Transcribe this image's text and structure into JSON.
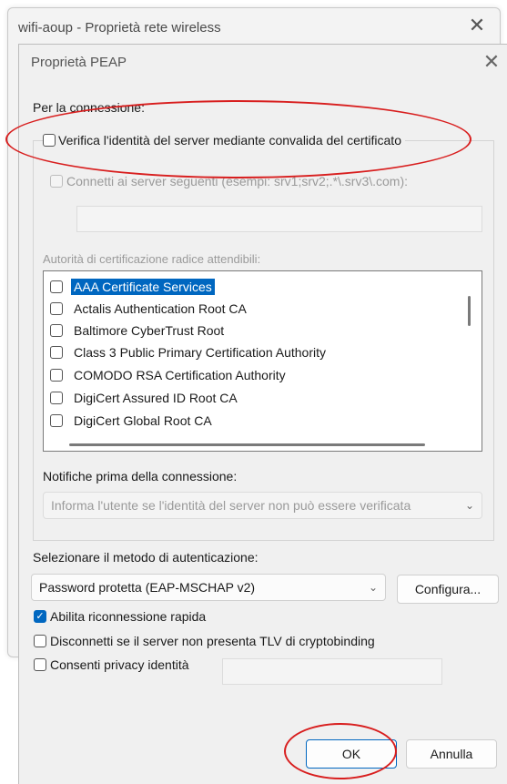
{
  "back_window": {
    "title": "wifi-aoup - Proprietà rete wireless",
    "close_glyph": "✕"
  },
  "dialog": {
    "title": "Proprietà PEAP",
    "close_glyph": "✕"
  },
  "connection": {
    "section_label": "Per la connessione:",
    "verify_server": {
      "label": "Verifica l'identità del server mediante convalida del certificato",
      "checked": false
    },
    "connect_servers": {
      "label": "Connetti ai server seguenti (esempi: srv1;srv2;.*\\.srv3\\.com):",
      "checked": false,
      "value": ""
    },
    "trusted_ca_label": "Autorità di certificazione radice attendibili:",
    "certificates": [
      {
        "label": "AAA Certificate Services",
        "checked": false,
        "selected": true
      },
      {
        "label": "Actalis Authentication Root CA",
        "checked": false,
        "selected": false
      },
      {
        "label": "Baltimore CyberTrust Root",
        "checked": false,
        "selected": false
      },
      {
        "label": "Class 3 Public Primary Certification Authority",
        "checked": false,
        "selected": false
      },
      {
        "label": "COMODO RSA Certification Authority",
        "checked": false,
        "selected": false
      },
      {
        "label": "DigiCert Assured ID Root CA",
        "checked": false,
        "selected": false
      },
      {
        "label": "DigiCert Global Root CA",
        "checked": false,
        "selected": false
      }
    ],
    "notifications_label": "Notifiche prima della connessione:",
    "notifications_value": "Informa l'utente se l'identità del server non può essere verificata"
  },
  "auth": {
    "method_label": "Selezionare il metodo di autenticazione:",
    "method_value": "Password protetta (EAP-MSCHAP v2)",
    "configure_button": "Configura...",
    "fast_reconnect": {
      "label": "Abilita riconnessione rapida",
      "checked": true
    },
    "disconnect_tlv": {
      "label": "Disconnetti se il server non presenta TLV di cryptobinding",
      "checked": false
    },
    "identity_privacy": {
      "label": "Consenti privacy identità",
      "checked": false,
      "value": ""
    }
  },
  "buttons": {
    "ok": "OK",
    "cancel": "Annulla"
  },
  "icons": {
    "chevron": "chevron-down-icon",
    "check": "checkmark-icon",
    "close": "close-icon"
  },
  "colors": {
    "accent": "#0067c0",
    "annotation": "#d81e1e"
  }
}
